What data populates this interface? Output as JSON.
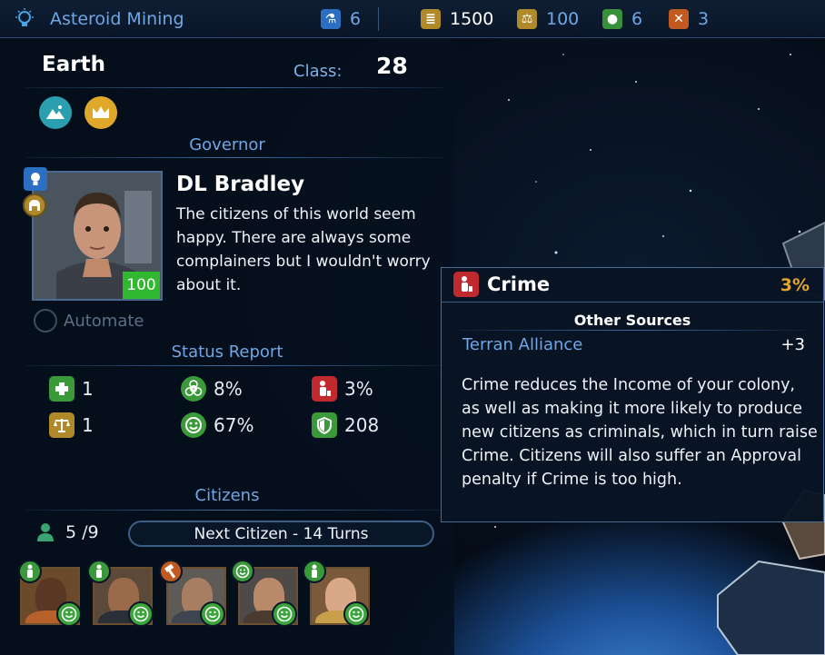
{
  "topbar": {
    "title": "Asteroid Mining",
    "research": "6",
    "credits": "1500",
    "influence": "100",
    "food": "6",
    "military": "3"
  },
  "planet": {
    "name": "Earth",
    "class_label": "Class:",
    "class_value": "28",
    "traits": [
      "mountain-trait-icon",
      "crown-trait-icon"
    ]
  },
  "governor": {
    "section_title": "Governor",
    "name": "DL Bradley",
    "text": "The citizens of this world seem happy. There are always some complainers but I wouldn't worry about it.",
    "level": "100",
    "automate_label": "Automate"
  },
  "status": {
    "section_title": "Status Report",
    "health": "1",
    "pollution": "8%",
    "crime": "3%",
    "influence": "1",
    "approval": "67%",
    "defense": "208"
  },
  "citizens": {
    "section_title": "Citizens",
    "count": "5 /9",
    "next_citizen": "Next Citizen - 14 Turns"
  },
  "tooltip": {
    "title": "Crime",
    "percent": "3%",
    "subheading": "Other Sources",
    "source_name": "Terran Alliance",
    "source_value": "+3",
    "description": "Crime reduces the Income of your colony, as well as making it more likely to produce new citizens as criminals, which in turn raise Crime. Citizens will also suffer an Approval penalty if Crime is too high."
  },
  "colors": {
    "accent_blue": "#6fa7e6",
    "crime_red": "#c0292d",
    "approval_green": "#3aa53a",
    "gold": "#b08a2a"
  }
}
